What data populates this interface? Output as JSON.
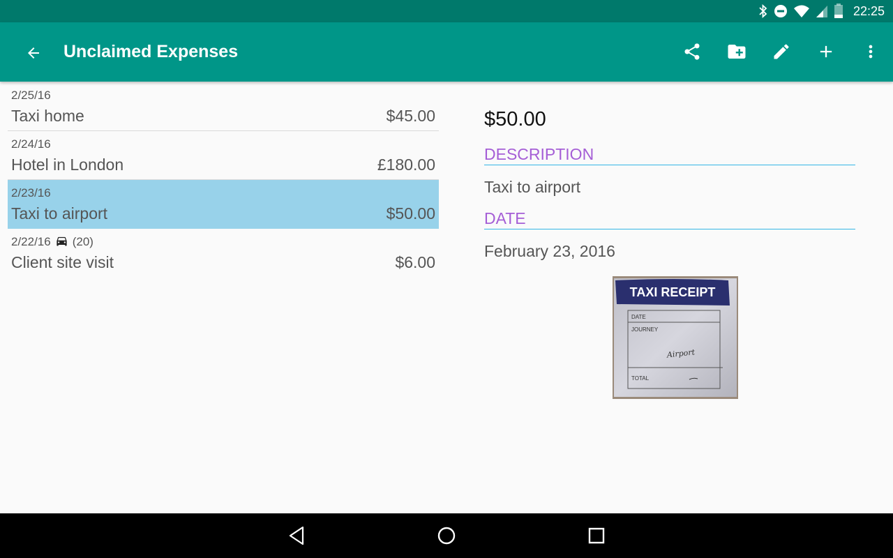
{
  "status_bar": {
    "time": "22:25",
    "icons": [
      "bluetooth-icon",
      "do-not-disturb-icon",
      "wifi-icon",
      "cell-signal-icon",
      "battery-icon"
    ]
  },
  "toolbar": {
    "title": "Unclaimed Expenses",
    "back_icon": "arrow-back-icon",
    "actions": [
      "share-icon",
      "create-folder-icon",
      "edit-icon",
      "add-icon",
      "more-vert-icon"
    ],
    "color": "#009688",
    "status_color": "#00796b"
  },
  "expenses": [
    {
      "date": "2/25/16",
      "description": "Taxi home",
      "amount": "$45.00"
    },
    {
      "date": "2/24/16",
      "description": "Hotel in London",
      "amount": "£180.00"
    },
    {
      "date": "2/23/16",
      "description": "Taxi to airport",
      "amount": "$50.00",
      "selected": true
    },
    {
      "date": "2/22/16",
      "mileage": "(20)",
      "description": "Client site visit",
      "amount": "$6.00"
    }
  ],
  "detail": {
    "amount": "$50.00",
    "description_label": "DESCRIPTION",
    "description": "Taxi to airport",
    "date_label": "DATE",
    "date": "February 23, 2016",
    "receipt": {
      "heading": "TAXI RECEIPT",
      "field_date": "DATE",
      "field_journey": "JOURNEY",
      "field_total": "TOTAL",
      "handwriting": "Airport"
    }
  },
  "colors": {
    "selected_row": "#98d2ea",
    "label": "#a55ed6",
    "underline": "#33b5e5"
  },
  "nav_bar": [
    "back-triangle-icon",
    "home-circle-icon",
    "recents-square-icon"
  ]
}
